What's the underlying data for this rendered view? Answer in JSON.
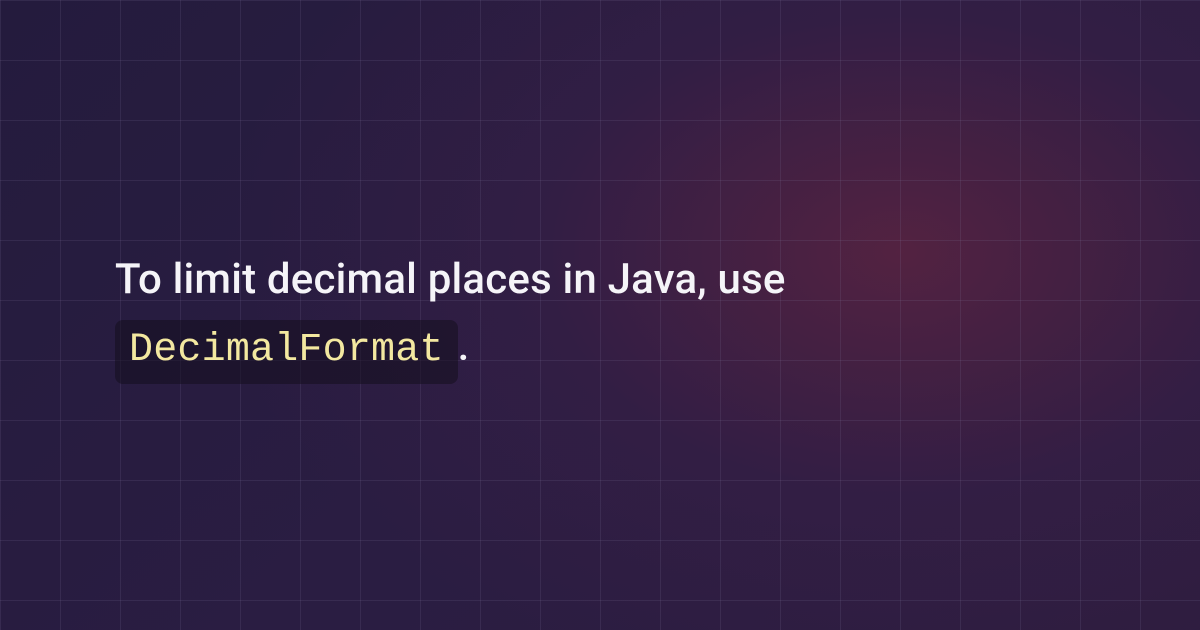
{
  "card": {
    "text_before_code": "To limit decimal places in Java, use ",
    "code_token": "DecimalFormat",
    "text_after_code": "."
  }
}
